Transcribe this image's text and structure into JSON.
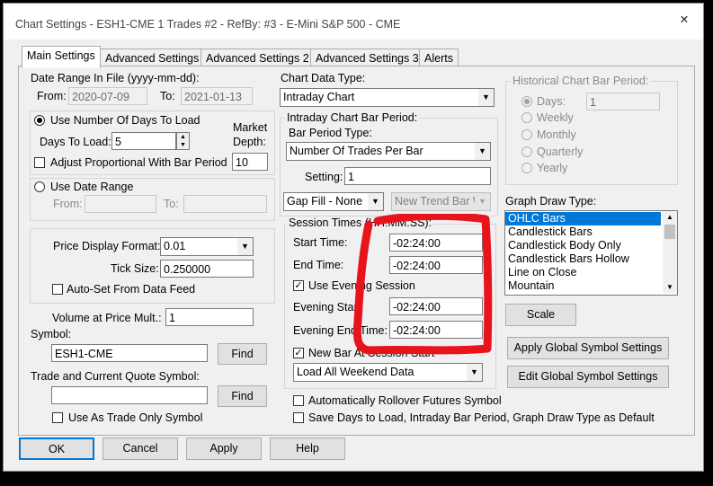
{
  "window": {
    "title": "Chart Settings - ESH1-CME  1 Trades  #2 - RefBy: #3 - E-Mini S&P 500 - CME",
    "close_glyph": "✕"
  },
  "tabs": [
    {
      "label": "Main Settings",
      "active": true
    },
    {
      "label": "Advanced Settings"
    },
    {
      "label": "Advanced Settings 2"
    },
    {
      "label": "Advanced Settings 3"
    },
    {
      "label": "Alerts"
    }
  ],
  "date_range": {
    "label": "Date Range In File (yyyy-mm-dd):",
    "from_label": "From:",
    "from_value": "2020-07-09",
    "to_label": "To:",
    "to_value": "2021-01-13"
  },
  "days_load": {
    "radio_label": "Use Number Of Days To Load",
    "days_label": "Days To Load:",
    "days_value": "5",
    "market_depth_label_1": "Market",
    "market_depth_label_2": "Depth:",
    "market_depth_value": "10",
    "adjust_label": "Adjust Proportional With Bar Period"
  },
  "date_range_option": {
    "radio_label": "Use Date Range",
    "from_label": "From:",
    "to_label": "To:"
  },
  "price": {
    "format_label": "Price Display Format:",
    "format_value": "0.01",
    "tick_label": "Tick Size:",
    "tick_value": "0.250000",
    "autoset_label": "Auto-Set From Data Feed"
  },
  "volume": {
    "label": "Volume at Price Mult.:",
    "value": "1"
  },
  "symbol": {
    "label": "Symbol:",
    "value": "ESH1-CME",
    "find": "Find"
  },
  "trade_symbol": {
    "label": "Trade and Current Quote Symbol:",
    "value": "",
    "find": "Find",
    "trade_only_label": "Use As Trade Only Symbol"
  },
  "chart_data": {
    "label": "Chart Data Type:",
    "value": "Intraday Chart"
  },
  "intraday": {
    "group_label": "Intraday Chart Bar Period:",
    "bar_type_label": "Bar Period Type:",
    "bar_type_value": "Number Of Trades Per Bar",
    "setting_label": "Setting:",
    "setting_value": "1",
    "gap_fill_value": "Gap Fill - None",
    "new_trend_value": "New Trend Bar W"
  },
  "session": {
    "group_label": "Session Times (HH:MM:SS):",
    "start_label": "Start Time:",
    "start_value": "-02:24:00",
    "end_label": "End Time:",
    "end_value": "-02:24:00",
    "evening_label": "Use Evening Session",
    "evening_start_label": "Evening Start:",
    "evening_start_value": "-02:24:00",
    "evening_end_label": "Evening End Time:",
    "evening_end_value": "-02:24:00",
    "new_bar_label": "New Bar At Session Start",
    "weekend_value": "Load All Weekend Data"
  },
  "auto_rollover_label": "Automatically Rollover Futures Symbol",
  "save_days_label": "Save Days to Load, Intraday Bar Period, Graph Draw Type as Default",
  "historical": {
    "group_label": "Historical Chart Bar Period:",
    "options": [
      "Days:",
      "Weekly",
      "Monthly",
      "Quarterly",
      "Yearly"
    ],
    "days_value": "1"
  },
  "graph_draw": {
    "label": "Graph Draw Type:",
    "items": [
      "OHLC Bars",
      "Candlestick Bars",
      "Candlestick Body Only",
      "Candlestick Bars Hollow",
      "Line on Close",
      "Mountain"
    ],
    "selected": "OHLC Bars"
  },
  "buttons": {
    "scale": "Scale",
    "apply_global": "Apply Global Symbol Settings",
    "edit_global": "Edit Global Symbol Settings",
    "ok": "OK",
    "cancel": "Cancel",
    "apply": "Apply",
    "help": "Help"
  },
  "colors": {
    "annotation": "#e8141c",
    "selection": "#0078d7"
  }
}
